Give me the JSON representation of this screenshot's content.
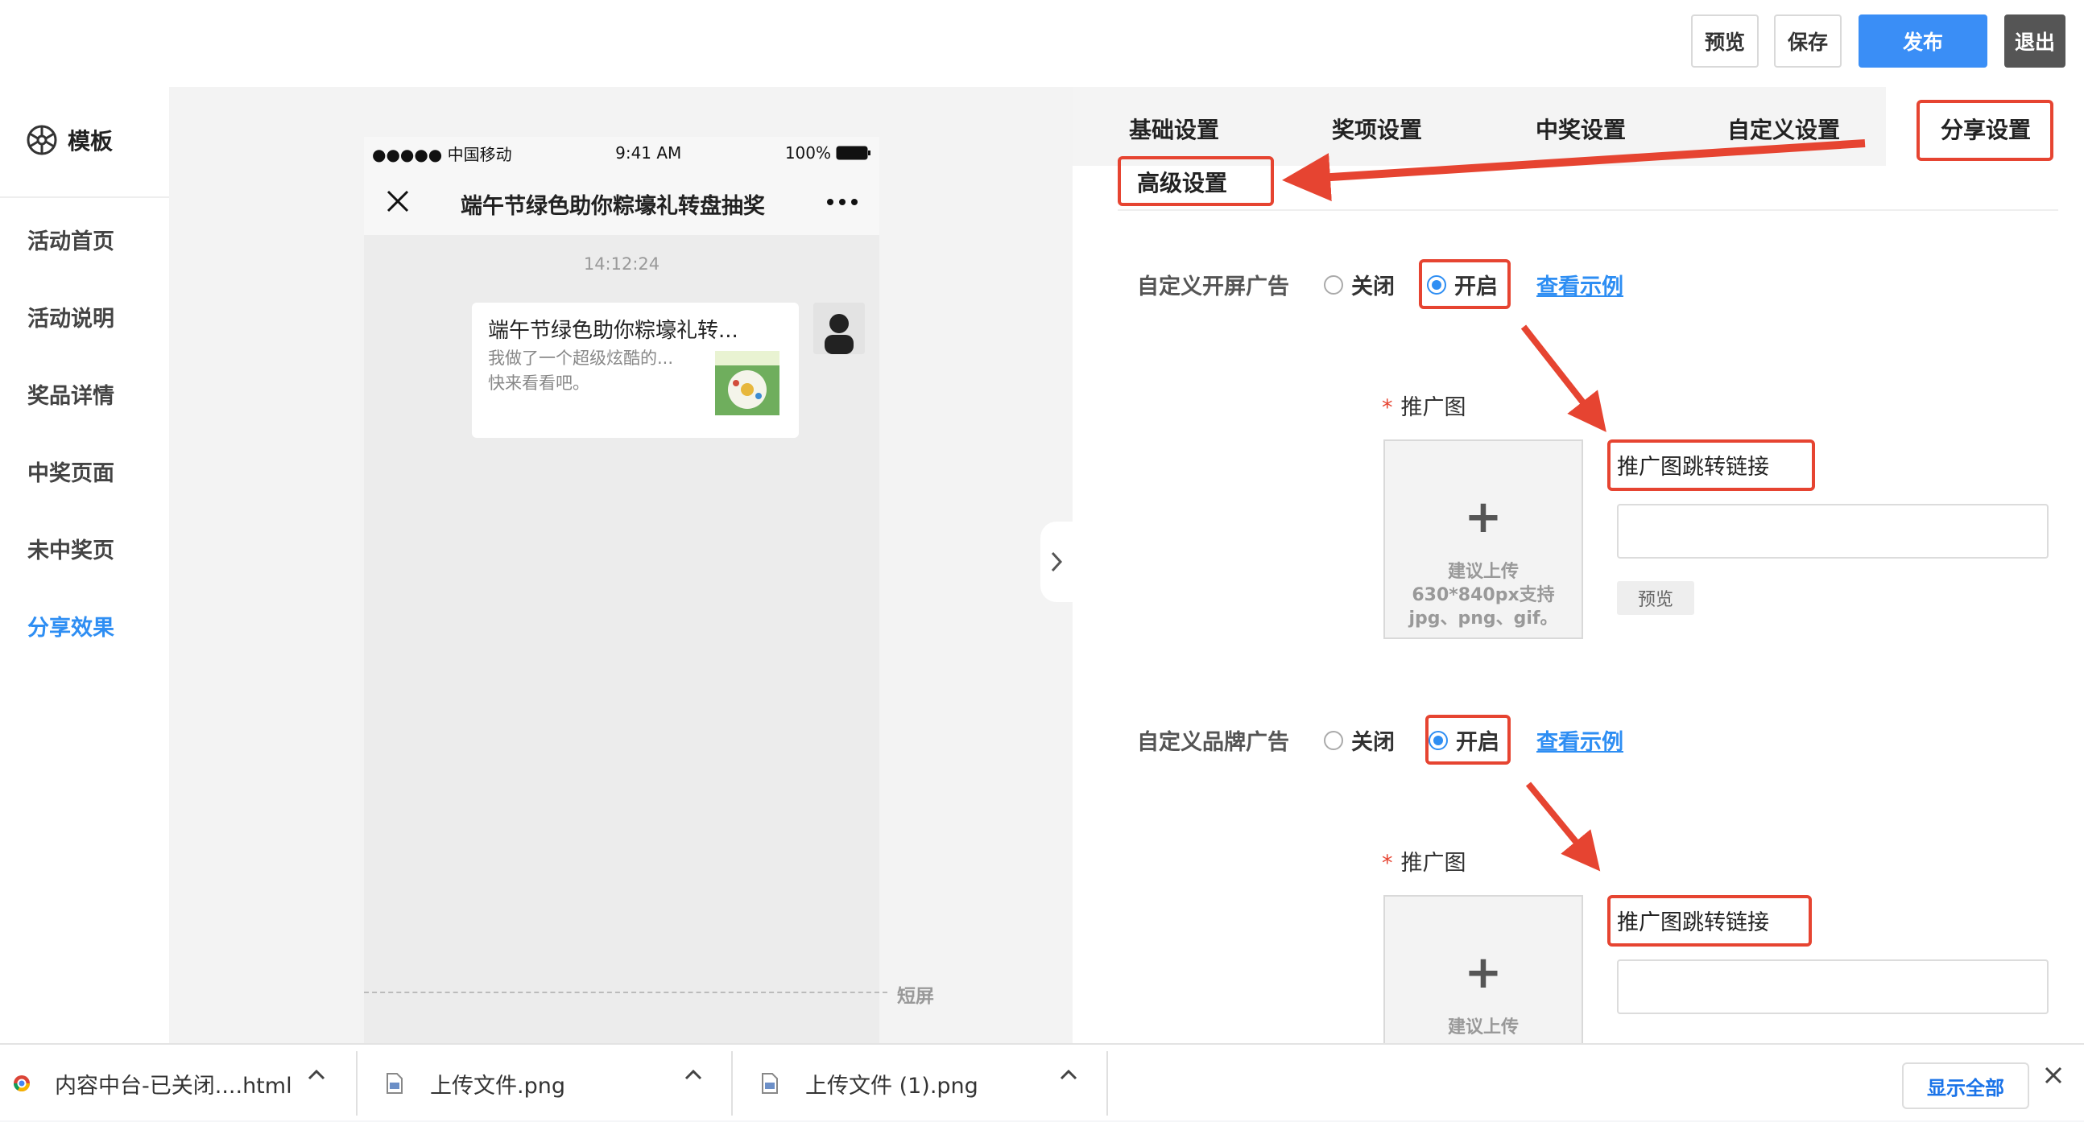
{
  "toolbar": {
    "preview_label": "预览",
    "save_label": "保存",
    "publish_label": "发布",
    "exit_label": "退出",
    "publish_color": "#3a8ef6"
  },
  "sidebar": {
    "logo_label": "模板",
    "logo_icon": "template-icon",
    "items": [
      {
        "label": "活动首页",
        "active": false
      },
      {
        "label": "活动说明",
        "active": false
      },
      {
        "label": "奖品详情",
        "active": false
      },
      {
        "label": "中奖页面",
        "active": false
      },
      {
        "label": "未中奖页",
        "active": false
      },
      {
        "label": "分享效果",
        "active": true
      }
    ],
    "active_color": "#2e8ef3"
  },
  "phone": {
    "carrier": "●●●●● 中国移动",
    "clock": "9:41 AM",
    "battery": "100%",
    "title": "端午节绿色助你粽壕礼转盘抽奖",
    "timestamp": "14:12:24",
    "card": {
      "title": "端午节绿色助你粽壕礼转...",
      "desc": "我做了一个超级炫酷的...\n快来看看吧。"
    },
    "short_screen_label": "短屏"
  },
  "tabs": [
    {
      "label": "基础设置"
    },
    {
      "label": "奖项设置"
    },
    {
      "label": "中奖设置"
    },
    {
      "label": "自定义设置"
    },
    {
      "label": "分享设置"
    },
    {
      "label": "高级设置"
    }
  ],
  "sections": [
    {
      "label": "自定义开屏广告",
      "off_label": "关闭",
      "on_label": "开启",
      "selected": "开启",
      "example_link": "查看示例",
      "required_label": "推广图",
      "upload_hint": "建议上传\n630*840px支持\njpg、png、gif。",
      "link_label": "推广图跳转链接",
      "link_value": "",
      "preview_label": "预览"
    },
    {
      "label": "自定义品牌广告",
      "off_label": "关闭",
      "on_label": "开启",
      "selected": "开启",
      "example_link": "查看示例",
      "required_label": "推广图",
      "upload_hint": "建议上传",
      "link_label": "推广图跳转链接",
      "link_value": ""
    }
  ],
  "annotation_color": "#e64431",
  "downloads": {
    "items": [
      {
        "name": "内容中台-已关闭....html",
        "icon": "chrome-icon"
      },
      {
        "name": "上传文件.png",
        "icon": "file-icon"
      },
      {
        "name": "上传文件 (1).png",
        "icon": "file-icon"
      }
    ],
    "show_all_label": "显示全部"
  }
}
